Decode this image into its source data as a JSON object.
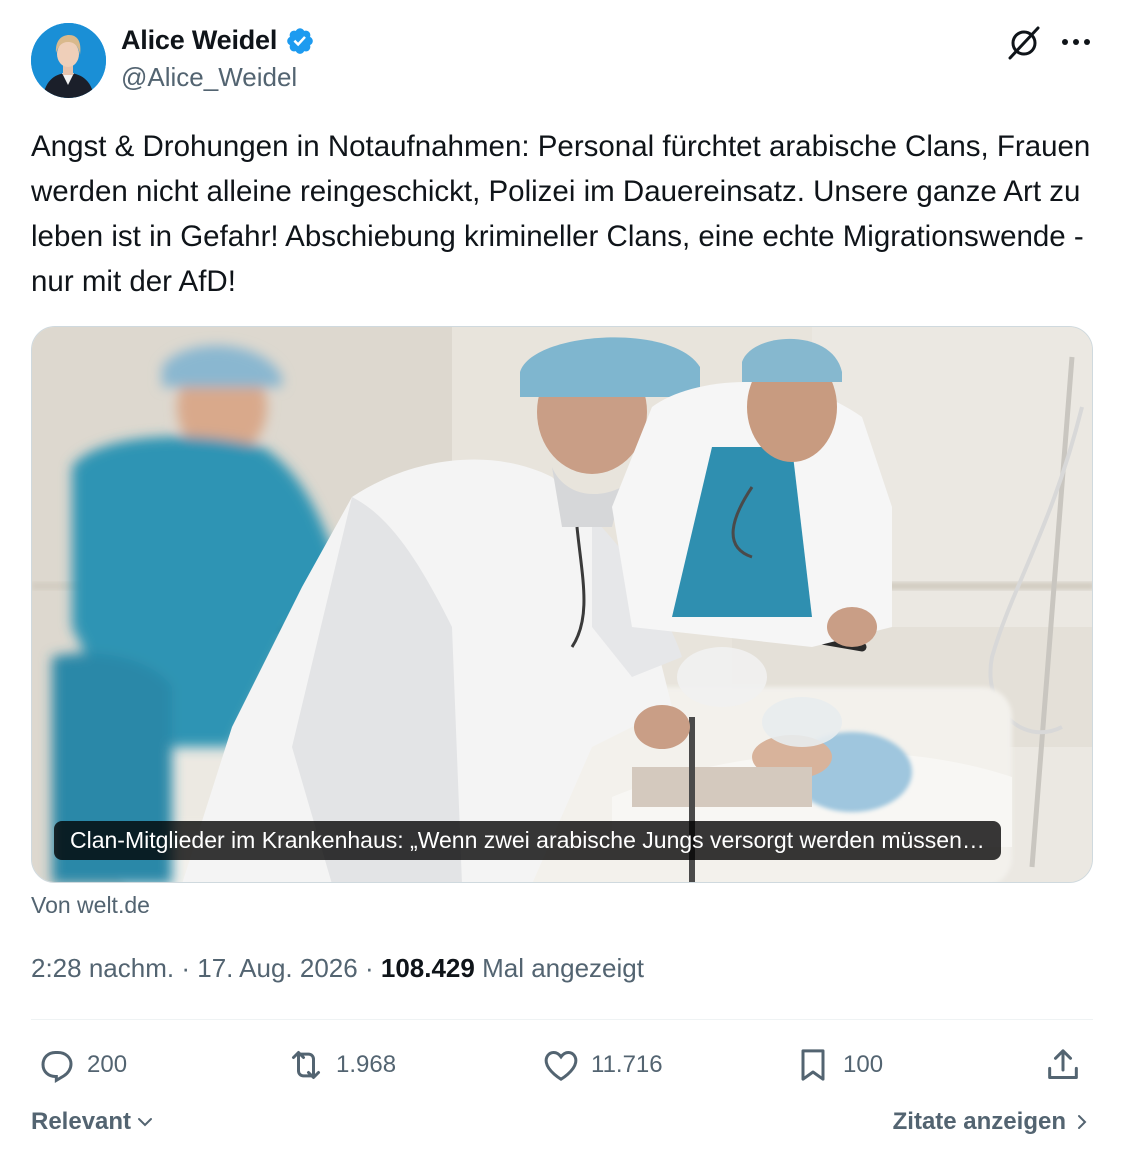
{
  "author": {
    "name": "Alice Weidel",
    "handle": "@Alice_Weidel",
    "verified": true,
    "verified_color": "#1d9bf0"
  },
  "icons": {
    "avatar": "profile-photo",
    "verified": "verified-badge-icon",
    "grok": "grok-icon",
    "more": "more-icon"
  },
  "tweet": {
    "text": "Angst & Drohungen in Notaufnahmen: Personal fürchtet arabische Clans, Frauen werden nicht alleine reingeschickt, Polizei im Dauereinsatz. Unsere ganze Art zu leben ist in Gefahr! Abschiebung krimineller Clans, eine echte Migrationswende - nur mit der AfD!"
  },
  "card": {
    "caption": "Clan-Mitglieder im Krankenhaus: „Wenn zwei arabische Jungs versorgt werden müssen…",
    "source": "Von welt.de"
  },
  "meta": {
    "time": "2:28 nachm.",
    "separator": "·",
    "date": "17. Aug. 2026",
    "views": "108.429",
    "views_label": "Mal angezeigt"
  },
  "actions": {
    "replies": "200",
    "reposts": "1.968",
    "likes": "11.716",
    "bookmarks": "100"
  },
  "footer": {
    "sort_label": "Relevant",
    "quotes_label": "Zitate anzeigen"
  },
  "colors": {
    "text_primary": "#0f1419",
    "text_secondary": "#536471",
    "border": "#cfd9de",
    "accent": "#1d9bf0"
  }
}
